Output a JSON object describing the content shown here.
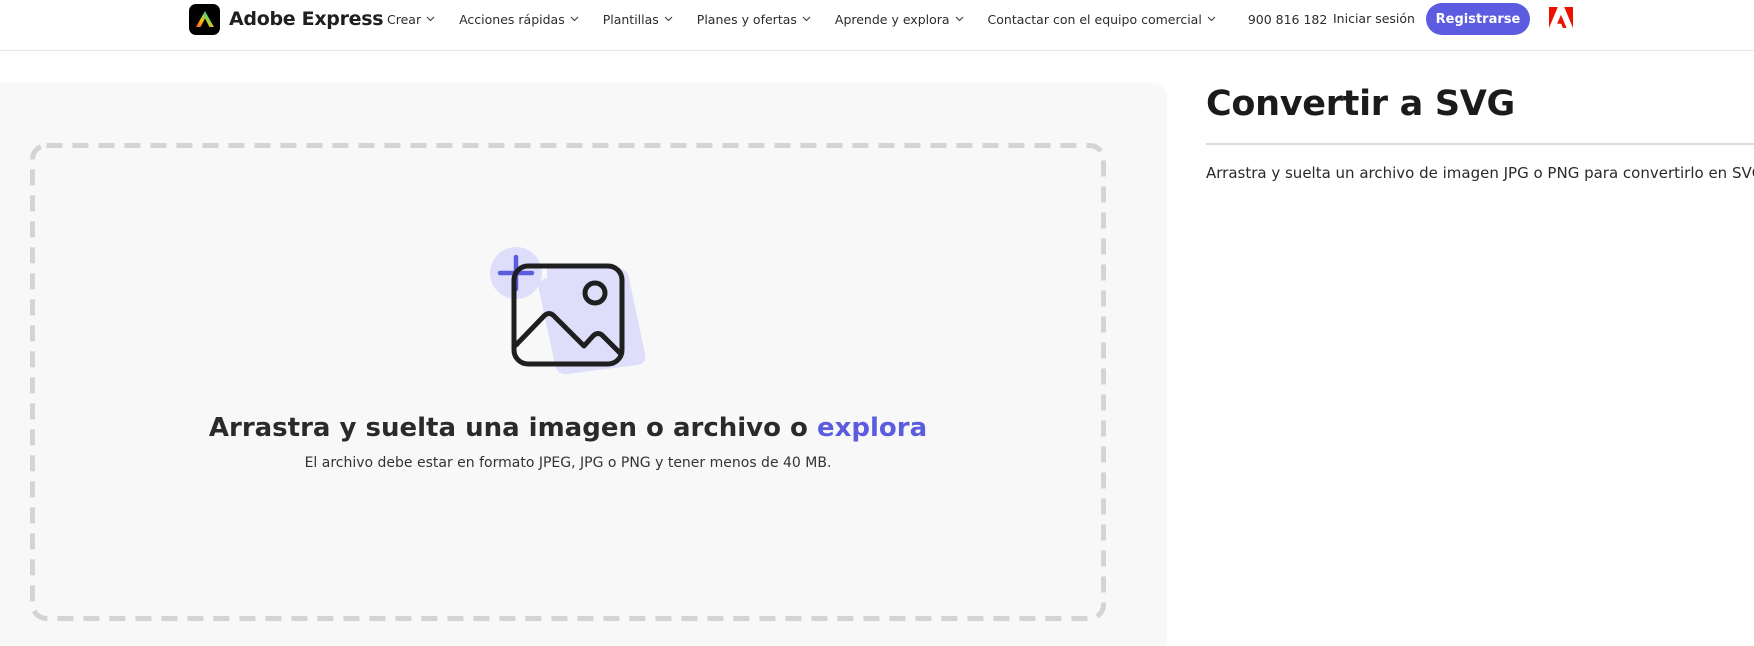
{
  "header": {
    "brand_name": "Adobe Express",
    "nav_items": [
      {
        "label": "Crear"
      },
      {
        "label": "Acciones rápidas"
      },
      {
        "label": "Plantillas"
      },
      {
        "label": "Planes y ofertas"
      },
      {
        "label": "Aprende y explora"
      },
      {
        "label": "Contactar con el equipo comercial"
      }
    ],
    "phone": "900 816 182",
    "login_label": "Iniciar sesión",
    "signup_label": "Registrarse"
  },
  "upload": {
    "heading": "Arrastra y suelta una imagen o archivo o",
    "browse_label": "explora",
    "subtext": "El archivo debe estar en formato JPEG, JPG o PNG y tener menos de 40 MB."
  },
  "info": {
    "title": "Convertir a SVG",
    "description": "Arrastra y suelta un archivo de imagen JPG o PNG para convertirlo en SVG."
  },
  "colors": {
    "accent": "#5c5ce0",
    "adobe_red": "#eb1000",
    "panel_background": "#f8f8f8",
    "dropzone_border": "#d4d4d4",
    "illustration_tint": "#dedefa"
  }
}
